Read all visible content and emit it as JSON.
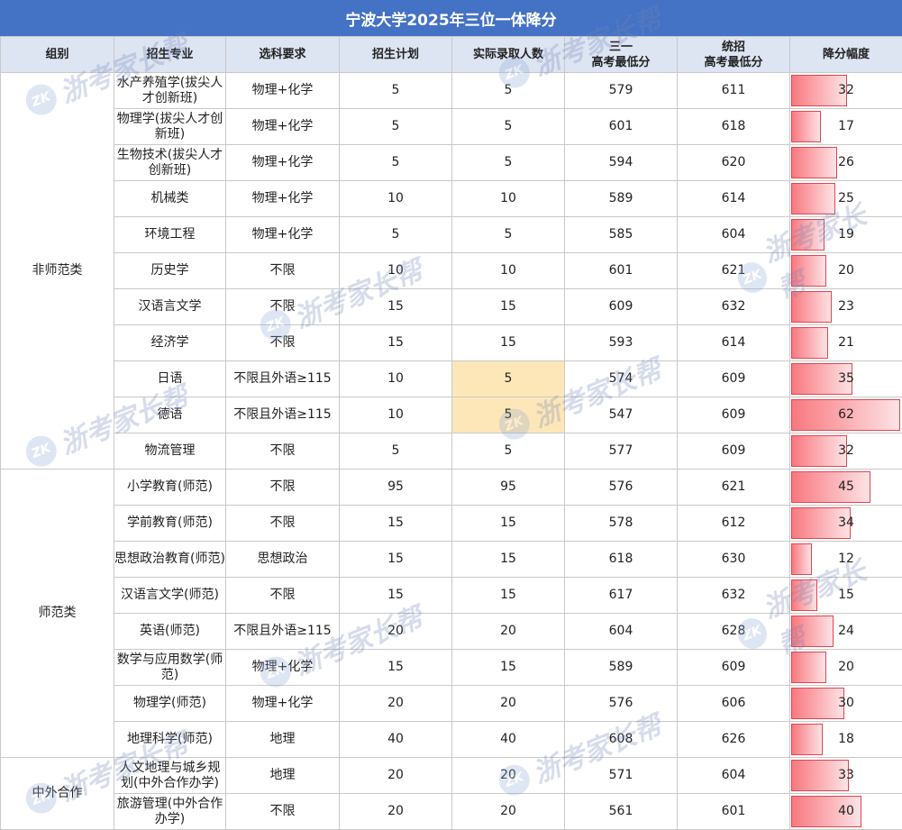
{
  "title": "宁波大学2025年三位一体降分",
  "headers": [
    "组别",
    "招生专业",
    "选科要求",
    "招生计划",
    "实际录取人数",
    "三一\n高考最低分",
    "统招\n高考最低分",
    "降分幅度"
  ],
  "groups": [
    {
      "name": "非师范类",
      "rows": [
        {
          "major": "水产养殖学(拔尖人才创新班)",
          "subject": "物理+化学",
          "plan": "5",
          "admitted": "5",
          "sanyi": "579",
          "tongzhao": "611",
          "drop": 32
        },
        {
          "major": "物理学(拔尖人才创新班)",
          "subject": "物理+化学",
          "plan": "5",
          "admitted": "5",
          "sanyi": "601",
          "tongzhao": "618",
          "drop": 17
        },
        {
          "major": "生物技术(拔尖人才创新班)",
          "subject": "物理+化学",
          "plan": "5",
          "admitted": "5",
          "sanyi": "594",
          "tongzhao": "620",
          "drop": 26
        },
        {
          "major": "机械类",
          "subject": "物理+化学",
          "plan": "10",
          "admitted": "10",
          "sanyi": "589",
          "tongzhao": "614",
          "drop": 25
        },
        {
          "major": "环境工程",
          "subject": "物理+化学",
          "plan": "5",
          "admitted": "5",
          "sanyi": "585",
          "tongzhao": "604",
          "drop": 19
        },
        {
          "major": "历史学",
          "subject": "不限",
          "plan": "10",
          "admitted": "10",
          "sanyi": "601",
          "tongzhao": "621",
          "drop": 20
        },
        {
          "major": "汉语言文学",
          "subject": "不限",
          "plan": "15",
          "admitted": "15",
          "sanyi": "609",
          "tongzhao": "632",
          "drop": 23
        },
        {
          "major": "经济学",
          "subject": "不限",
          "plan": "15",
          "admitted": "15",
          "sanyi": "593",
          "tongzhao": "614",
          "drop": 21
        },
        {
          "major": "日语",
          "subject": "不限且外语≥115",
          "plan": "10",
          "admitted": "5",
          "sanyi": "574",
          "tongzhao": "609",
          "drop": 35,
          "highlight": true
        },
        {
          "major": "德语",
          "subject": "不限且外语≥115",
          "plan": "10",
          "admitted": "5",
          "sanyi": "547",
          "tongzhao": "609",
          "drop": 62,
          "highlight": true
        },
        {
          "major": "物流管理",
          "subject": "不限",
          "plan": "5",
          "admitted": "5",
          "sanyi": "577",
          "tongzhao": "609",
          "drop": 32
        }
      ]
    },
    {
      "name": "师范类",
      "rows": [
        {
          "major": "小学教育(师范)",
          "subject": "不限",
          "plan": "95",
          "admitted": "95",
          "sanyi": "576",
          "tongzhao": "621",
          "drop": 45
        },
        {
          "major": "学前教育(师范)",
          "subject": "不限",
          "plan": "15",
          "admitted": "15",
          "sanyi": "578",
          "tongzhao": "612",
          "drop": 34
        },
        {
          "major": "思想政治教育(师范)",
          "subject": "思想政治",
          "plan": "15",
          "admitted": "15",
          "sanyi": "618",
          "tongzhao": "630",
          "drop": 12
        },
        {
          "major": "汉语言文学(师范)",
          "subject": "不限",
          "plan": "15",
          "admitted": "15",
          "sanyi": "617",
          "tongzhao": "632",
          "drop": 15
        },
        {
          "major": "英语(师范)",
          "subject": "不限且外语≥115",
          "plan": "20",
          "admitted": "20",
          "sanyi": "604",
          "tongzhao": "628",
          "drop": 24
        },
        {
          "major": "数学与应用数学(师范)",
          "subject": "物理+化学",
          "plan": "15",
          "admitted": "15",
          "sanyi": "589",
          "tongzhao": "609",
          "drop": 20
        },
        {
          "major": "物理学(师范)",
          "subject": "物理+化学",
          "plan": "20",
          "admitted": "20",
          "sanyi": "576",
          "tongzhao": "606",
          "drop": 30
        },
        {
          "major": "地理科学(师范)",
          "subject": "地理",
          "plan": "40",
          "admitted": "40",
          "sanyi": "608",
          "tongzhao": "626",
          "drop": 18
        }
      ]
    },
    {
      "name": "中外合作",
      "rows": [
        {
          "major": "人文地理与城乡规划(中外合作办学)",
          "subject": "地理",
          "plan": "20",
          "admitted": "20",
          "sanyi": "571",
          "tongzhao": "604",
          "drop": 33
        },
        {
          "major": "旅游管理(中外合作办学)",
          "subject": "不限",
          "plan": "20",
          "admitted": "20",
          "sanyi": "561",
          "tongzhao": "601",
          "drop": 40
        }
      ]
    }
  ],
  "bar_max": 62,
  "colors": {
    "header_bg": "#4472c4",
    "subheader_bg": "#dde4f2",
    "highlight": "#fde7b8",
    "bar": "#f87880"
  },
  "watermark": {
    "logo": "ZK",
    "text": "浙考家长帮"
  }
}
